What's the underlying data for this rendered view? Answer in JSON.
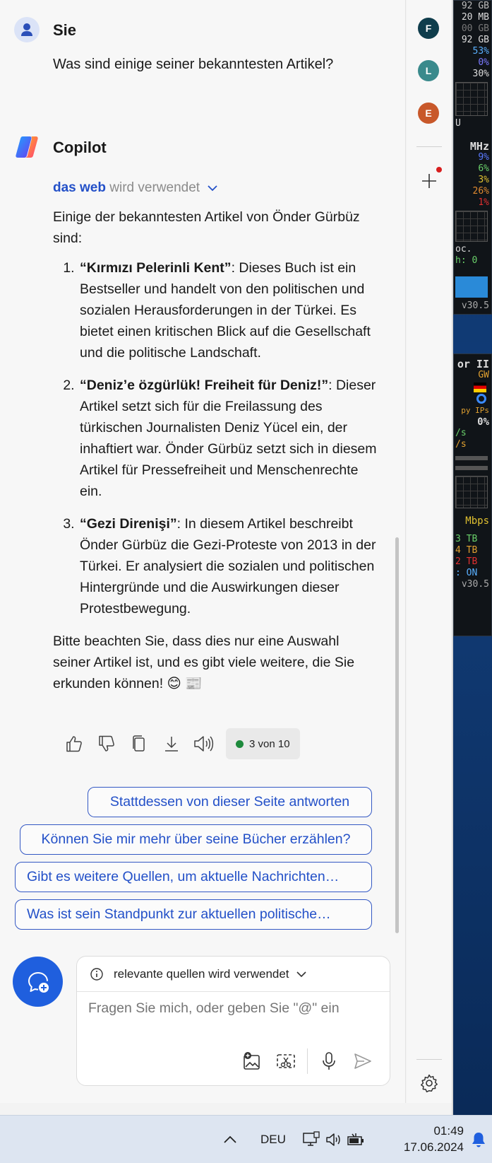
{
  "user": {
    "name": "Sie",
    "question": "Was sind einige seiner bekanntesten Artikel?"
  },
  "copilot": {
    "name": "Copilot",
    "source_label": "das web",
    "source_suffix": "wird verwendet",
    "intro": "Einige der bekanntesten Artikel von Önder Gürbüz sind:",
    "items": [
      {
        "title": "“Kırmızı Pelerinli Kent”",
        "text": ": Dieses Buch ist ein Bestseller und handelt von den politischen und sozialen Herausforderungen in der Türkei. Es bietet einen kritischen Blick auf die Gesellschaft und die politische Landschaft."
      },
      {
        "title": "“Deniz’e özgürlük! Freiheit für Deniz!”",
        "text": ": Dieser Artikel setzt sich für die Freilassung des türkischen Journalisten Deniz Yücel ein, der inhaftiert war. Önder Gürbüz setzt sich in diesem Artikel für Pressefreiheit und Menschenrechte ein."
      },
      {
        "title": "“Gezi Direnişi”",
        "text": ": In diesem Artikel beschreibt Önder Gürbüz die Gezi-Proteste von 2013 in der Türkei. Er analysiert die sozialen und politischen Hintergründe und die Auswirkungen dieser Protestbewegung."
      }
    ],
    "outro": "Bitte beachten Sie, dass dies nur eine Auswahl seiner Artikel ist, und es gibt viele weitere, die Sie erkunden können! 😊 📰",
    "counter": "3 von 10"
  },
  "suggestions": [
    "Stattdessen von dieser Seite antworten",
    "Können Sie mir mehr über seine Bücher erzählen?",
    "Gibt es weitere Quellen, um aktuelle Nachrichten…",
    "Was ist sein Standpunkt zur aktuellen politische…"
  ],
  "composer": {
    "mode_label": "relevante quellen wird verwendet",
    "placeholder": "Fragen Sie mich, oder geben Sie \"@\" ein"
  },
  "sidebar": {
    "avatars": [
      {
        "letter": "F",
        "color": "#0f3d4c"
      },
      {
        "letter": "L",
        "color": "#3a8a8c"
      },
      {
        "letter": "E",
        "color": "#c8582a"
      }
    ]
  },
  "gadget": {
    "lines_a": [
      "92 GB",
      "20 MB",
      "00 GB",
      "92 GB",
      "53%",
      "0%",
      "30%"
    ],
    "label_a": "U",
    "mhz": "MHz",
    "lines_b": [
      "9%",
      "6%",
      "3%",
      "26%",
      "1%"
    ],
    "lines_c": [
      "oc.",
      "h: 0"
    ],
    "version_a": "v30.5",
    "title_b": "or II",
    "lines_d": [
      "GW",
      "py IPs",
      "0%",
      "/s",
      "/s"
    ],
    "mbps": "Mbps",
    "lines_e": [
      "3 TB",
      "4 TB",
      "2 TB",
      ": ON",
      "v30.5"
    ]
  },
  "taskbar": {
    "lang": "DEU",
    "time": "01:49",
    "date": "17.06.2024"
  }
}
